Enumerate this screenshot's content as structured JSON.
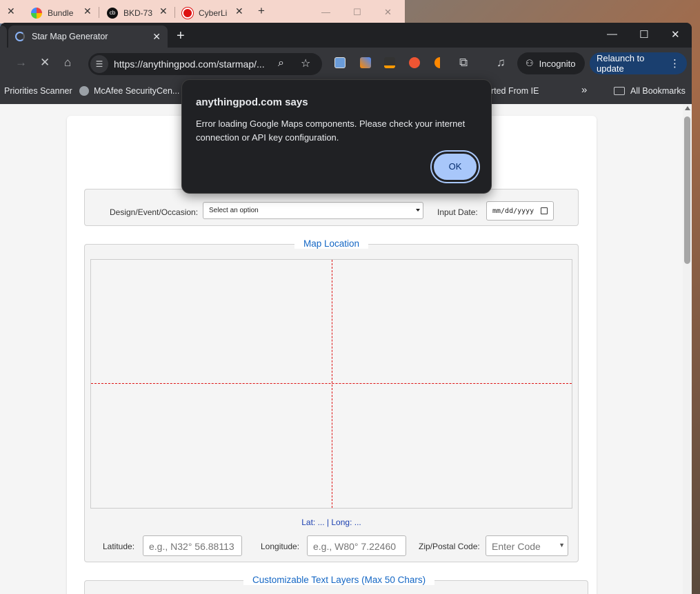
{
  "background_window": {
    "tabs": [
      {
        "label": "Bundle"
      },
      {
        "label": "BKD-73"
      },
      {
        "label": "CyberLi"
      }
    ]
  },
  "tabs": {
    "active_title": "Star Map Generator"
  },
  "toolbar": {
    "url": "https://anythingpod.com/starmap/...",
    "incognito_label": "Incognito",
    "relaunch_label": "Relaunch to update"
  },
  "bookmarks": {
    "items": [
      "Priorities Scanner",
      "McAfee SecurityCen...",
      "orted From IE"
    ],
    "all_bookmarks": "All Bookmarks"
  },
  "dialog": {
    "title": "anythingpod.com says",
    "message": "Error loading Google Maps components. Please check your internet connection or API key configuration.",
    "ok_label": "OK"
  },
  "form": {
    "design_label": "Design/Event/Occasion:",
    "design_value": "Select an option",
    "date_label": "Input Date:",
    "date_value": "mm/dd/yyyy"
  },
  "map_section": {
    "legend": "Map Location",
    "latlong_text": "Lat: ... | Long: ...",
    "latitude_label": "Latitude:",
    "latitude_placeholder": "e.g., N32° 56.88113",
    "longitude_label": "Longitude:",
    "longitude_placeholder": "e.g., W80° 7.22460",
    "zip_label": "Zip/Postal Code:",
    "zip_placeholder": "Enter Code"
  },
  "text_layers": {
    "legend": "Customizable Text Layers (Max 50 Chars)"
  },
  "colors": {
    "accent_blue": "#1366c4",
    "crosshair": "#dd1111",
    "dialog_bg": "#202124",
    "ok_button": "#a8c7fa"
  }
}
